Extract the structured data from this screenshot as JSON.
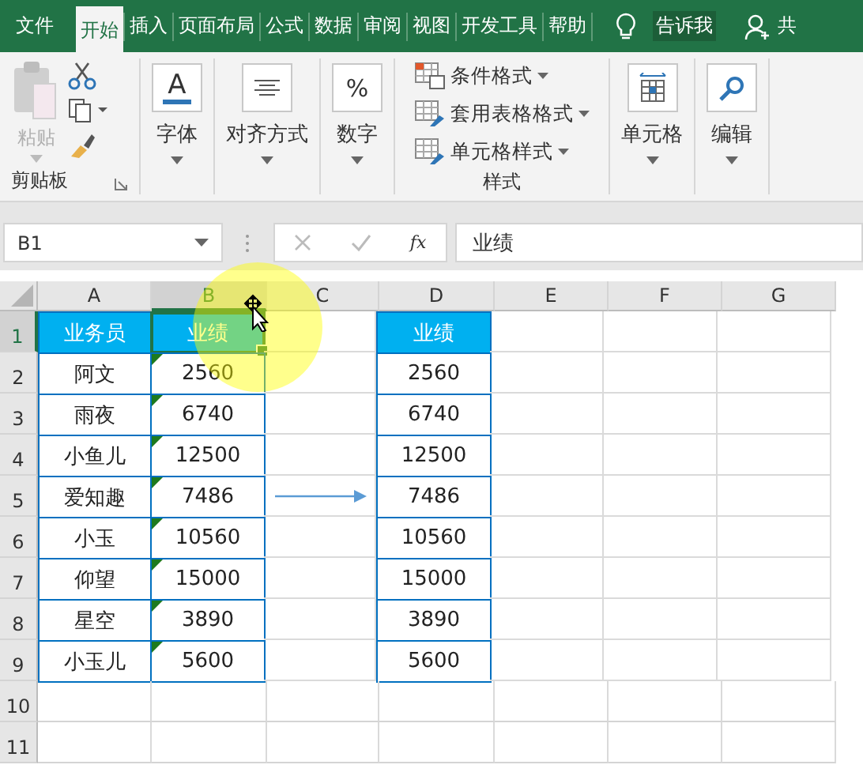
{
  "menu_tabs": [
    {
      "label": "文件",
      "selected": false
    },
    {
      "label": "开始",
      "selected": true
    },
    {
      "label": "插入",
      "selected": false
    },
    {
      "label": "页面布局",
      "selected": false
    },
    {
      "label": "公式",
      "selected": false
    },
    {
      "label": "数据",
      "selected": false
    },
    {
      "label": "审阅",
      "selected": false
    },
    {
      "label": "视图",
      "selected": false
    },
    {
      "label": "开发工具",
      "selected": false
    },
    {
      "label": "帮助",
      "selected": false
    }
  ],
  "tell_me": "告诉我",
  "share": "共",
  "ribbon_groups": [
    {
      "kind": "clipboard",
      "paste": "粘贴",
      "paste_disabled": true,
      "label": "剪贴板"
    },
    {
      "kind": "font",
      "icon_text": "A",
      "button": "字体"
    },
    {
      "kind": "align",
      "button": "对齐方式"
    },
    {
      "kind": "number",
      "icon_text": "%",
      "button": "数字"
    },
    {
      "kind": "styles",
      "items": [
        "条件格式",
        "套用表格格式",
        "单元格样式"
      ],
      "label": "样式"
    },
    {
      "kind": "cells",
      "button": "单元格"
    },
    {
      "kind": "edit",
      "button": "编辑"
    }
  ],
  "name_box": "B1",
  "fx": "fx",
  "formula": "业绩",
  "columns": [
    {
      "label": "A",
      "selected": false
    },
    {
      "label": "B",
      "selected": true
    },
    {
      "label": "C",
      "selected": false
    },
    {
      "label": "D",
      "selected": false
    },
    {
      "label": "E",
      "selected": false
    },
    {
      "label": "F",
      "selected": false
    },
    {
      "label": "G",
      "selected": false
    }
  ],
  "rows": [
    {
      "number": "1",
      "selected": true,
      "kind": "header",
      "a": {
        "text": "业务员",
        "selected": false,
        "flag": false
      },
      "b": {
        "text": "业绩",
        "selected": true,
        "flag": false
      },
      "d": {
        "text": "业绩",
        "selected": false,
        "flag": false
      }
    },
    {
      "number": "2",
      "selected": false,
      "kind": "data",
      "a": {
        "text": "阿文",
        "selected": false,
        "flag": false
      },
      "b": {
        "text": "2560",
        "selected": false,
        "flag": true
      },
      "d": {
        "text": "2560",
        "selected": false,
        "flag": false
      }
    },
    {
      "number": "3",
      "selected": false,
      "kind": "data",
      "a": {
        "text": "雨夜",
        "selected": false,
        "flag": false
      },
      "b": {
        "text": "6740",
        "selected": false,
        "flag": true
      },
      "d": {
        "text": "6740",
        "selected": false,
        "flag": false
      }
    },
    {
      "number": "4",
      "selected": false,
      "kind": "data",
      "a": {
        "text": "小鱼儿",
        "selected": false,
        "flag": false
      },
      "b": {
        "text": "12500",
        "selected": false,
        "flag": true
      },
      "d": {
        "text": "12500",
        "selected": false,
        "flag": false
      }
    },
    {
      "number": "5",
      "selected": false,
      "kind": "data",
      "arrow": true,
      "a": {
        "text": "爱知趣",
        "selected": false,
        "flag": false
      },
      "b": {
        "text": "7486",
        "selected": false,
        "flag": true
      },
      "d": {
        "text": "7486",
        "selected": false,
        "flag": false
      }
    },
    {
      "number": "6",
      "selected": false,
      "kind": "data",
      "a": {
        "text": "小玉",
        "selected": false,
        "flag": false
      },
      "b": {
        "text": "10560",
        "selected": false,
        "flag": true
      },
      "d": {
        "text": "10560",
        "selected": false,
        "flag": false
      }
    },
    {
      "number": "7",
      "selected": false,
      "kind": "data",
      "a": {
        "text": "仰望",
        "selected": false,
        "flag": false
      },
      "b": {
        "text": "15000",
        "selected": false,
        "flag": true
      },
      "d": {
        "text": "15000",
        "selected": false,
        "flag": false
      }
    },
    {
      "number": "8",
      "selected": false,
      "kind": "data",
      "a": {
        "text": "星空",
        "selected": false,
        "flag": false
      },
      "b": {
        "text": "3890",
        "selected": false,
        "flag": true
      },
      "d": {
        "text": "3890",
        "selected": false,
        "flag": false
      }
    },
    {
      "number": "9",
      "selected": false,
      "kind": "data",
      "a": {
        "text": "小玉儿",
        "selected": false,
        "flag": false
      },
      "b": {
        "text": "5600",
        "selected": false,
        "flag": true
      },
      "d": {
        "text": "5600",
        "selected": false,
        "flag": false
      }
    },
    {
      "number": "10",
      "selected": false,
      "kind": "empty"
    },
    {
      "number": "11",
      "selected": false,
      "kind": "empty"
    }
  ]
}
